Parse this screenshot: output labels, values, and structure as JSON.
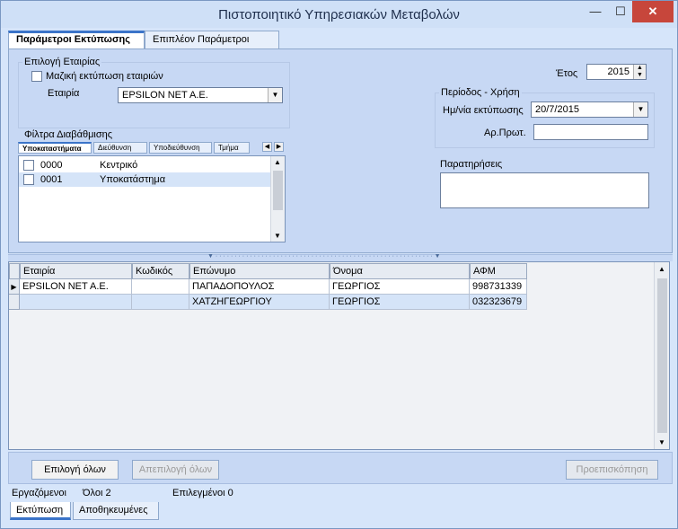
{
  "window": {
    "title": "Πιστοποιητικό Υπηρεσιακών Μεταβολών",
    "min_glyph": "—",
    "max_glyph": "☐",
    "close_glyph": "✕"
  },
  "tabs": [
    "Παράμετροι Εκτύπωσης",
    "Επιπλέον Παράμετροι"
  ],
  "company_group": {
    "legend": "Επιλογή Εταιρίας",
    "mass_print_label": "Μαζική εκτύπωση εταιριών",
    "company_label": "Εταιρία",
    "company_value": "EPSILON NET A.E."
  },
  "year": {
    "label": "Έτος",
    "value": "2015"
  },
  "period_group": {
    "legend": "Περίοδος - Χρήση",
    "print_date_label": "Ημ/νία εκτύπωσης",
    "print_date_value": "20/7/2015",
    "protocol_label": "Αρ.Πρωτ.",
    "protocol_value": ""
  },
  "notes": {
    "legend": "Παρατηρήσεις",
    "value": ""
  },
  "filter_group": {
    "legend": "Φίλτρα Διαβάθμισης",
    "subtabs": [
      "Υποκαταστήματα",
      "Διεύθυνση",
      "Υποδιεύθυνση",
      "Τμήμα"
    ],
    "items": [
      {
        "code": "0000",
        "name": "Κεντρικό"
      },
      {
        "code": "0001",
        "name": "Υποκατάστημα"
      }
    ]
  },
  "grid": {
    "columns": [
      "Εταιρία",
      "Κωδικός",
      "Επώνυμο",
      "Όνομα",
      "ΑΦΜ"
    ],
    "rows": [
      [
        "EPSILON NET A.E.",
        "",
        "ΠΑΠΑΔΟΠΟΥΛΟΣ",
        "ΓΕΩΡΓΙΟΣ",
        "998731339"
      ],
      [
        "",
        "",
        "ΧΑΤΖΗΓΕΩΡΓΙΟΥ",
        "ΓΕΩΡΓΙΟΣ",
        "032323679"
      ]
    ]
  },
  "buttons": {
    "select_all": "Επιλογή όλων",
    "deselect_all": "Απεπιλογή όλων",
    "preview": "Προεπισκόπηση"
  },
  "status": {
    "employees_label": "Εργαζόμενοι",
    "all_label": "Όλοι 2",
    "selected_label": "Επιλεγμένοι 0"
  },
  "bottom_tabs": [
    "Εκτύπωση",
    "Αποθηκευμένες"
  ]
}
